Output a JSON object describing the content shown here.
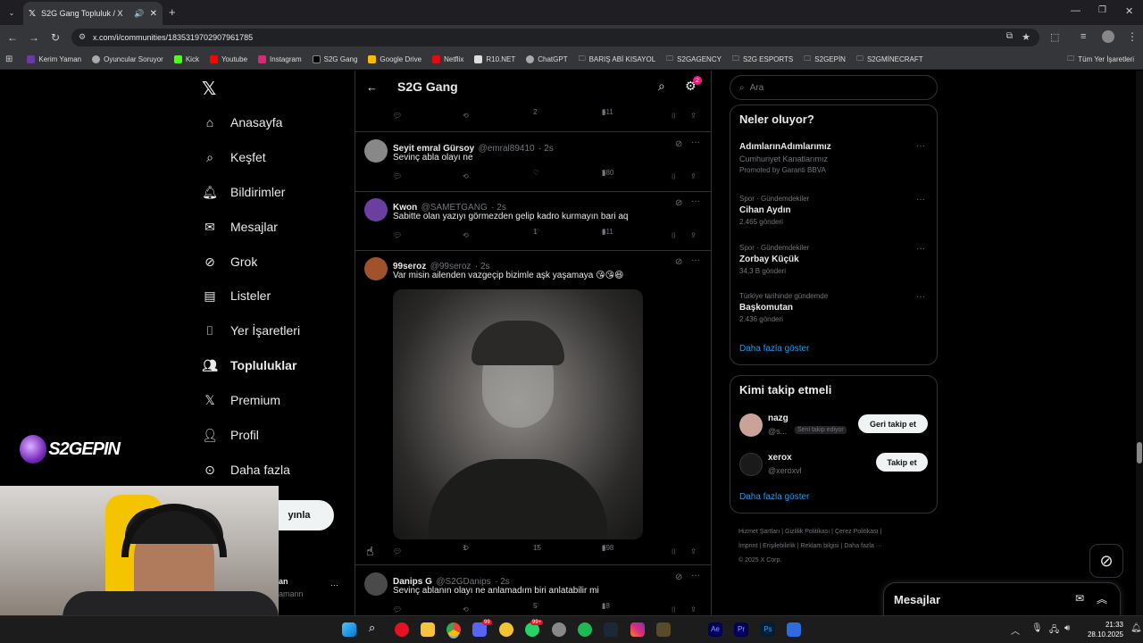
{
  "browser": {
    "tab_title": "S2G Gang Topluluk / X",
    "url": "x.com/i/communities/1835319702907961785",
    "bookmarks": [
      "Kerim Yaman",
      "Oyuncular Soruyor",
      "Kick",
      "Youtube",
      "Instagram",
      "S2G Gang",
      "Google Drive",
      "Netflix",
      "R10.NET",
      "ChatGPT",
      "BARIŞ ABİ KISAYOL",
      "S2GAGENCY",
      "S2G ESPORTS",
      "S2GEPİN",
      "S2GMİNECRAFT"
    ],
    "all_bookmarks": "Tüm Yer İşaretleri"
  },
  "nav": {
    "items": [
      "Anasayfa",
      "Keşfet",
      "Bildirimler",
      "Mesajlar",
      "Grok",
      "Listeler",
      "Yer İşaretleri",
      "Topluluklar",
      "Premium",
      "Profil",
      "Daha fazla"
    ],
    "post_button_partial": "yınla",
    "account_name_partial": "an",
    "account_handle_partial": "amann"
  },
  "overlay": {
    "logo_text": "S2GEPIN"
  },
  "feed": {
    "title": "S2G Gang",
    "settings_badge": "2",
    "top_stats": {
      "likes": "2",
      "views": "611"
    },
    "tweets": [
      {
        "name": "Seyit emral Gürsoy",
        "handle": "@emral89410",
        "time": "· 2s",
        "text": "Sevinç abla olayı ne",
        "reply": "",
        "retweet": "",
        "likes": "",
        "views": "580"
      },
      {
        "name": "Kwon",
        "handle": "@SAMETGANG",
        "time": "· 2s",
        "text": "Sabitte olan yazıyı görmezden gelip kadro kurmayın bari aq",
        "reply": "",
        "retweet": "",
        "likes": "1",
        "views": "611"
      },
      {
        "name": "99seroz",
        "handle": "@99seroz",
        "time": "· 2s",
        "text": "Var misin ailenden vazgeçip bizimle aşk yaşamaya 😘😘😆",
        "reply": "",
        "retweet": "1",
        "likes": "15",
        "views": "698"
      },
      {
        "name": "Danips G",
        "handle": "@S2GDanips",
        "time": "· 2s",
        "text": "Sevinç ablanın olayı ne anlamadım biri anlatabilir mi",
        "reply": "",
        "retweet": "",
        "likes": "5",
        "views": "18"
      }
    ]
  },
  "sidebar": {
    "search_placeholder": "Ara",
    "whats_happening_title": "Neler oluyor?",
    "promoted": {
      "name": "AdımlarınAdımlarımız",
      "sub": "Cumhuriyet Kanatlarımız",
      "promo": "Promoted by Garanti BBVA"
    },
    "trends": [
      {
        "cat": "Spor · Gündemdekiler",
        "name": "Cihan Aydın",
        "count": "2.465 gönderi"
      },
      {
        "cat": "Spor · Gündemdekiler",
        "name": "Zorbay Küçük",
        "count": "34,3 B gönderi"
      },
      {
        "cat": "Türkiye tarihinde gündemde",
        "name": "Başkomutan",
        "count": "2.436 gönderi"
      }
    ],
    "show_more": "Daha fazla göster",
    "who_to_follow_title": "Kimi takip etmeli",
    "follow": [
      {
        "name": "nazg",
        "handle": "@s...",
        "badge": "Seni takip ediyor",
        "button": "Geri takip et"
      },
      {
        "name": "xerox",
        "handle": "@xeroxvl",
        "badge": "",
        "button": "Takip et"
      }
    ],
    "show_more2": "Daha fazla göster",
    "footer_links": [
      "Hizmet Şartları",
      "Gizlilik Politikası",
      "Çerez Politikası",
      "İmprint",
      "Erişilebilirlik",
      "Reklam bilgisi",
      "Daha fazla ···"
    ],
    "copyright": "© 2025 X Corp."
  },
  "messages_drawer": {
    "title": "Mesajlar"
  },
  "taskbar": {
    "time": "21:33",
    "date": "28.10.2025",
    "badge_discord": "99",
    "badge_whatsapp": "99+"
  },
  "colors": {
    "accent": "#1d9bf0",
    "background": "#000000",
    "border": "#2f3336"
  }
}
